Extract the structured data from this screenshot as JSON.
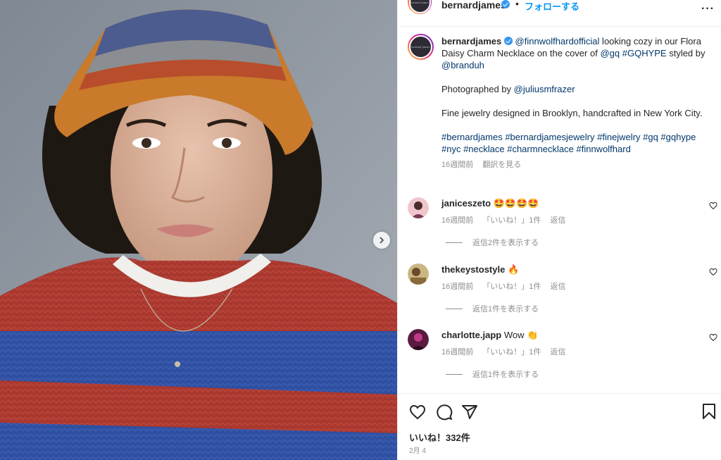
{
  "header": {
    "avatar_text": "bernard james",
    "username": "bernardjames",
    "separator": "•",
    "follow_label": "フォローする",
    "more_label": "···"
  },
  "caption": {
    "avatar_text": "bernard james",
    "username": "bernardjames",
    "segments": {
      "mention1": "@finnwolfhardofficial",
      "text1": " looking cozy in our Flora Daisy Charm Necklace on the cover of ",
      "mention2": "@gq",
      "space1": " ",
      "tag1": "#GQHYPE",
      "text2": " styled by ",
      "mention3": "@branduh"
    },
    "photo_prefix": "Photographed by ",
    "photo_mention": "@juliusmfrazer",
    "fine_text": "Fine jewelry designed in Brooklyn, handcrafted in New York City.",
    "hashtags": "#bernardjames #bernardjamesjewelry #finejwelry #gq #gqhype #nyc #necklace #charmnecklace #finnwolfhard",
    "time": "16週間前",
    "translate": "翻訳を見る"
  },
  "comments": [
    {
      "username": "janiceszeto",
      "text": "🤩🤩🤩🤩",
      "time": "16週間前",
      "likes": "「いいね！」1件",
      "reply": "返信",
      "view_replies": "返信2件を表示する",
      "avatar_color": "#e8b8c0"
    },
    {
      "username": "thekeystostyle",
      "text": "🔥",
      "time": "16週間前",
      "likes": "「いいね！」1件",
      "reply": "返信",
      "view_replies": "返信1件を表示する",
      "avatar_color": "#b9a66a"
    },
    {
      "username": "charlotte.japp",
      "text": "Wow 👏",
      "time": "16週間前",
      "likes": "「いいね！」1件",
      "reply": "返信",
      "view_replies": "返信1件を表示する",
      "avatar_color": "#6a1f4a"
    }
  ],
  "footer": {
    "likes": "いいね！332件",
    "date": "2月 4"
  },
  "colors": {
    "link": "#00376b",
    "follow": "#0095f6",
    "muted": "#8e8e8e"
  },
  "icons": [
    "chevron-right-icon",
    "verified-icon",
    "more-icon",
    "heart-icon",
    "comment-icon",
    "share-icon",
    "bookmark-icon"
  ]
}
